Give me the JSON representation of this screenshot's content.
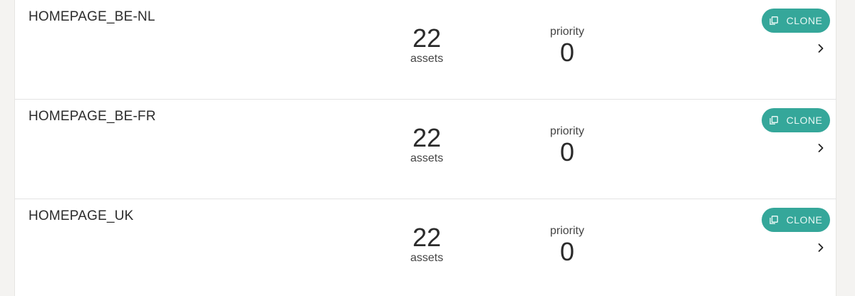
{
  "rows": [
    {
      "name": "HOMEPAGE_BE-NL",
      "assets_count": "22",
      "assets_label": "assets",
      "priority_label": "priority",
      "priority_value": "0",
      "clone_label": "CLONE"
    },
    {
      "name": "HOMEPAGE_BE-FR",
      "assets_count": "22",
      "assets_label": "assets",
      "priority_label": "priority",
      "priority_value": "0",
      "clone_label": "CLONE"
    },
    {
      "name": "HOMEPAGE_UK",
      "assets_count": "22",
      "assets_label": "assets",
      "priority_label": "priority",
      "priority_value": "0",
      "clone_label": "CLONE"
    }
  ],
  "icons": {
    "clone": "copy-icon",
    "open": "chevron-right-icon"
  },
  "colors": {
    "accent": "#35a79a",
    "background": "#f4f3f1",
    "panel": "#ffffff"
  }
}
